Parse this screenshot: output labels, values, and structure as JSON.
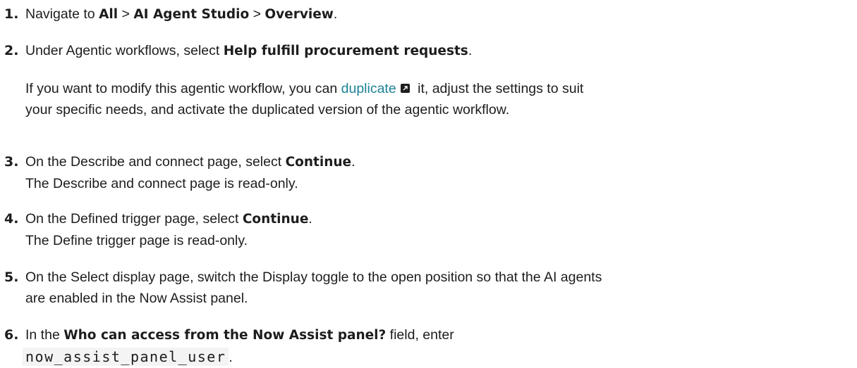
{
  "steps": [
    {
      "number": "1.",
      "pre": "Navigate to ",
      "crumb1": "All",
      "sep1": " > ",
      "crumb2": "AI Agent Studio",
      "sep2": " > ",
      "crumb3": "Overview",
      "post": "."
    },
    {
      "number": "2.",
      "pre": "Under Agentic workflows, select ",
      "bold": "Help fulfill procurement requests",
      "post": ".",
      "note_pre": "If you want to modify this agentic workflow, you can ",
      "note_link": "duplicate",
      "note_mid": " it, adjust the settings to suit",
      "note_line2": "your specific needs, and activate the duplicated version of the agentic workflow."
    },
    {
      "number": "3.",
      "pre": "On the Describe and connect page, select ",
      "bold": "Continue",
      "post": ".",
      "line2": "The Describe and connect page is read-only."
    },
    {
      "number": "4.",
      "pre": "On the Defined trigger page, select ",
      "bold": "Continue",
      "post": ".",
      "line2": "The Define trigger page is read-only."
    },
    {
      "number": "5.",
      "line1": "On the Select display page, switch the Display toggle to the open position so that the AI agents",
      "line2": "are enabled in the Now Assist panel."
    },
    {
      "number": "6.",
      "pre": "In the ",
      "bold": "Who can access from the Now Assist panel?",
      "post": " field, enter",
      "code": "now_assist_panel_user",
      "code_post": "."
    }
  ],
  "icons": {
    "external_link": "external-link-icon"
  },
  "colors": {
    "text": "#1d1d1d",
    "link": "#1d8296"
  }
}
